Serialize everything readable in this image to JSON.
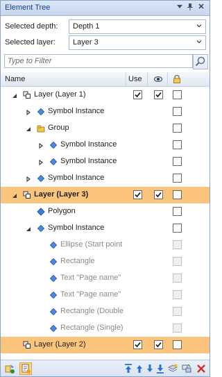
{
  "panel": {
    "title": "Element Tree",
    "title_icons": [
      "pin-dropdown-icon",
      "pin-icon",
      "close-icon"
    ]
  },
  "settings": {
    "depth_label": "Selected depth:",
    "depth_value": "Depth 1",
    "layer_label": "Selected layer:",
    "layer_value": "Layer 3"
  },
  "filter": {
    "placeholder": "Type to Filter",
    "value": ""
  },
  "columns": {
    "name": "Name",
    "use": "Use",
    "visible_icon": "eye-icon",
    "lock_icon": "lock-icon"
  },
  "tree": [
    {
      "label": "Layer (Layer 1)",
      "type": "layer",
      "expanded": true,
      "use": true,
      "visible": true,
      "locked": false
    },
    {
      "label": "Symbol Instance",
      "type": "symbol",
      "expanded": false,
      "locked": false
    },
    {
      "label": "Group",
      "type": "group",
      "expanded": true,
      "locked": false
    },
    {
      "label": "Symbol Instance",
      "type": "symbol",
      "expanded": false,
      "locked": false
    },
    {
      "label": "Symbol Instance",
      "type": "symbol",
      "expanded": false,
      "locked": false
    },
    {
      "label": "Symbol Instance",
      "type": "symbol",
      "expanded": false,
      "locked": false
    },
    {
      "label": "Layer (Layer 3)",
      "type": "layer",
      "expanded": true,
      "selected": true,
      "use": true,
      "visible": true,
      "locked": false
    },
    {
      "label": "Polygon",
      "type": "polygon",
      "locked": false
    },
    {
      "label": "Symbol Instance",
      "type": "symbol",
      "expanded": true,
      "locked": false
    },
    {
      "label": "Ellipse (Start point f",
      "type": "ellipse",
      "muted": true
    },
    {
      "label": "Rectangle",
      "type": "rectangle",
      "muted": true
    },
    {
      "label": "Text \"Page name\"",
      "type": "text",
      "muted": true
    },
    {
      "label": "Text \"Page name\"",
      "type": "text",
      "muted": true
    },
    {
      "label": "Rectangle (Double)",
      "type": "rectangle",
      "muted": true
    },
    {
      "label": "Rectangle (Single)",
      "type": "rectangle",
      "muted": true
    },
    {
      "label": "Layer (Layer 2)",
      "type": "layer",
      "selected": true,
      "use": true,
      "visible": true,
      "locked": false
    }
  ],
  "toolbar": {
    "left": [
      "add-layer-icon",
      "layer-properties-icon"
    ],
    "right": [
      "move-top-icon",
      "move-up-icon",
      "move-down-icon",
      "move-bottom-icon",
      "add-element-icon",
      "merge-icon",
      "delete-icon"
    ]
  }
}
